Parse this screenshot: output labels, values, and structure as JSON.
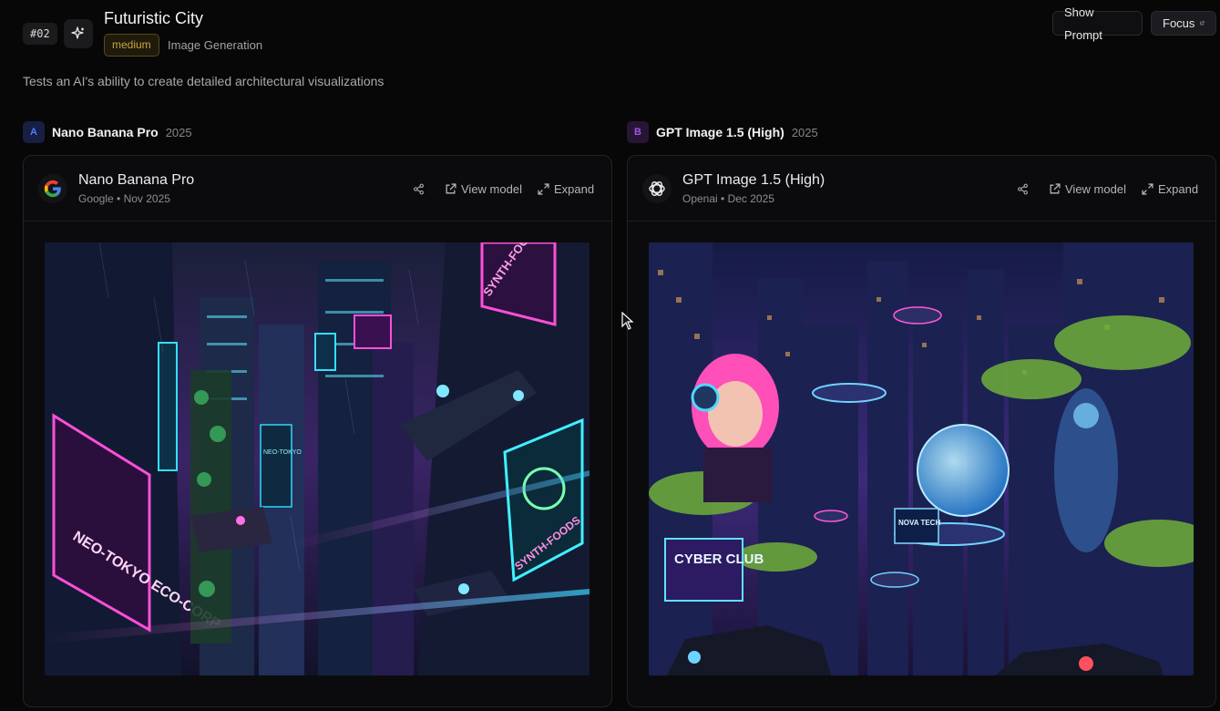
{
  "header": {
    "number": "#02",
    "title": "Futuristic City",
    "difficulty": "medium",
    "category": "Image Generation",
    "show_prompt_label": "Show Prompt",
    "focus_label": "Focus"
  },
  "description": "Tests an AI's ability to create detailed architectural visualizations",
  "columns": [
    {
      "letter": "A",
      "name": "Nano Banana Pro",
      "year": "2025",
      "card": {
        "model_name": "Nano Banana Pro",
        "meta": "Google • Nov 2025",
        "logo_icon": "google-icon",
        "view_model_label": "View model",
        "expand_label": "Expand",
        "image_signs": [
          "NEO-TOKYO ECO-CORP",
          "SYNTH-FOODS",
          "SYNTH-FOODS",
          "NEO-TOKYO"
        ]
      }
    },
    {
      "letter": "B",
      "name": "GPT Image 1.5 (High)",
      "year": "2025",
      "card": {
        "model_name": "GPT Image 1.5 (High)",
        "meta": "Openai • Dec 2025",
        "logo_icon": "openai-icon",
        "view_model_label": "View model",
        "expand_label": "Expand",
        "image_signs": [
          "CYBER CLUB",
          "NOVA TECH"
        ]
      }
    }
  ],
  "colors": {
    "difficulty_accent": "#c9a63e",
    "letter_a": "#4f7bff",
    "letter_b": "#a255e0"
  }
}
